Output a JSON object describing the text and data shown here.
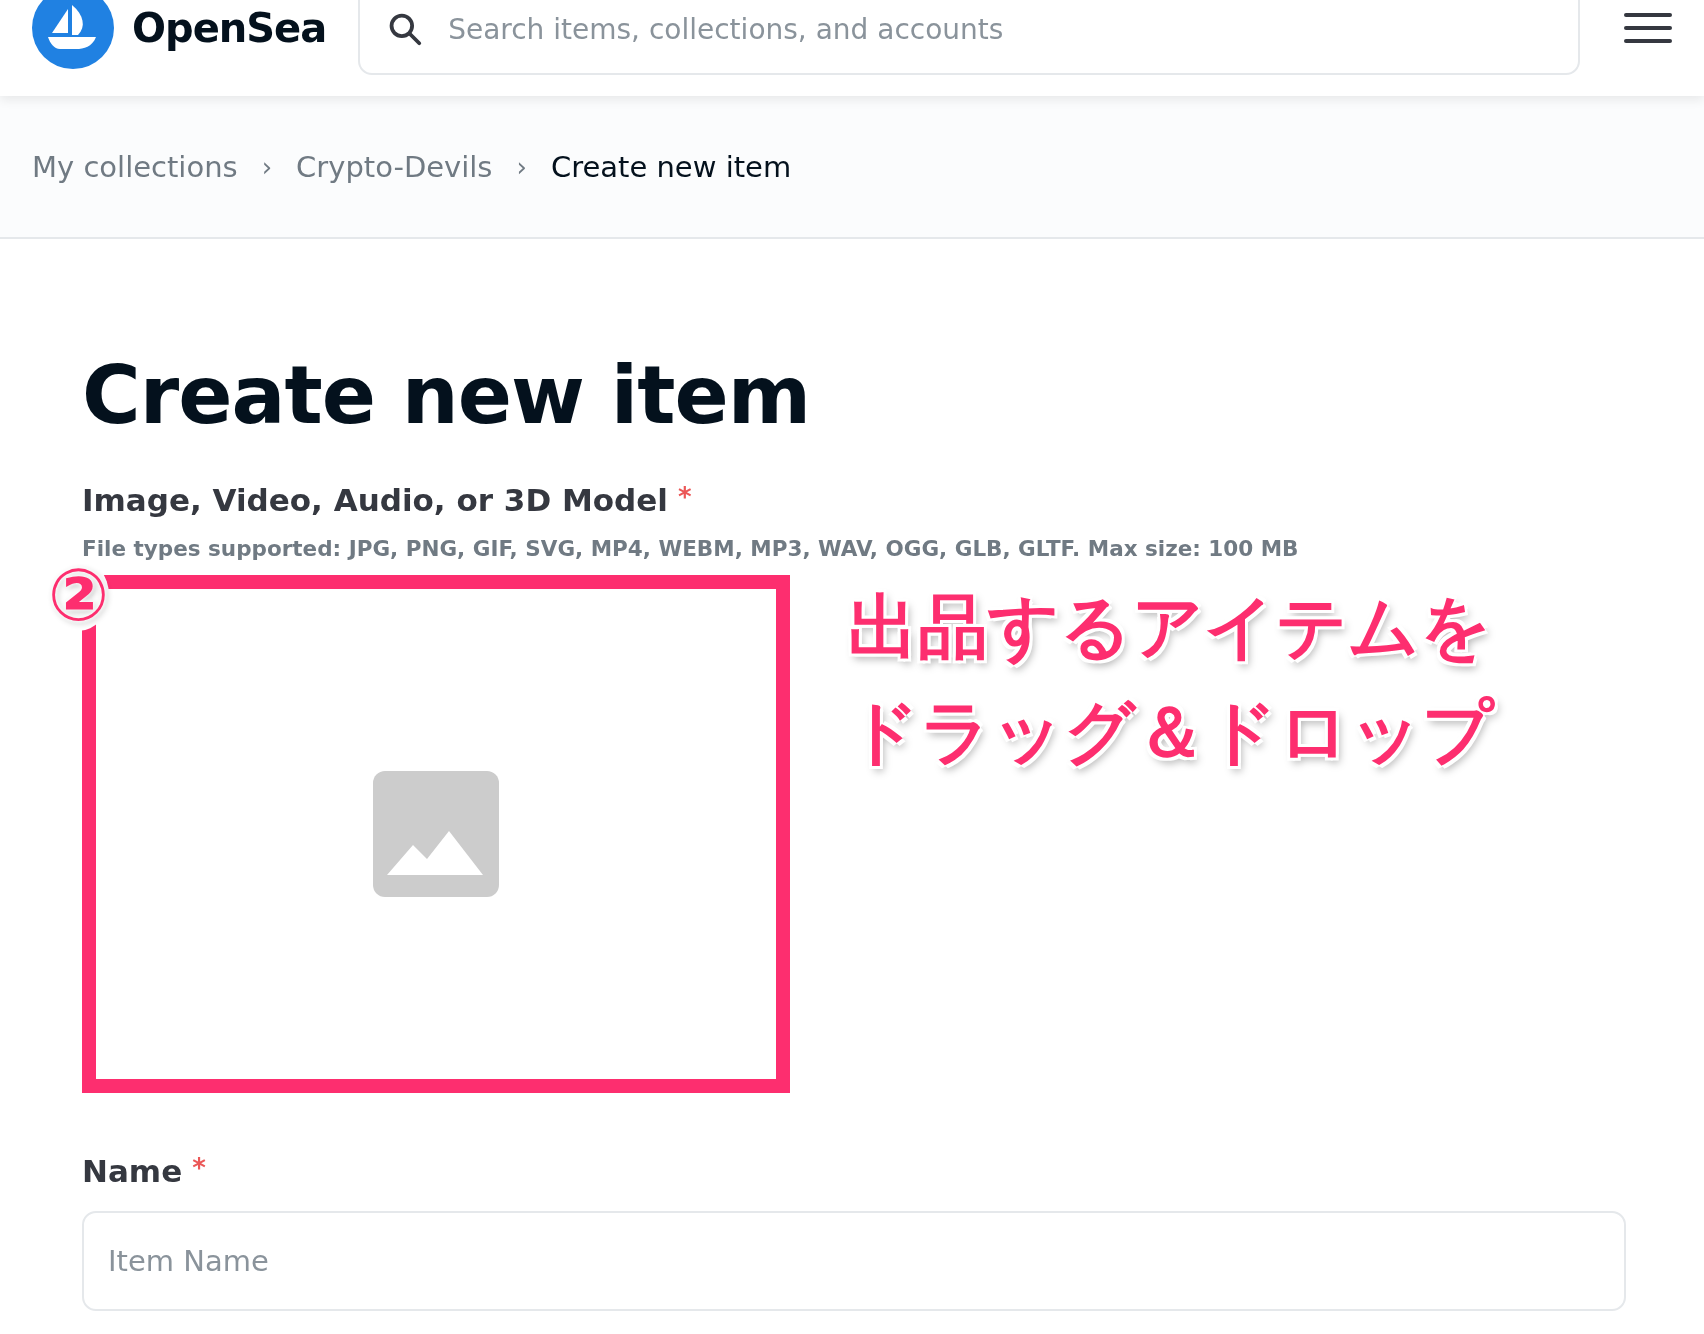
{
  "header": {
    "logo_text": "OpenSea",
    "search": {
      "placeholder": "Search items, collections, and accounts"
    }
  },
  "breadcrumbs": [
    {
      "label": "My collections",
      "current": false,
      "separator": "›"
    },
    {
      "label": "Crypto-Devils",
      "current": false,
      "separator": "›"
    },
    {
      "label": "Create new item",
      "current": true
    }
  ],
  "page": {
    "title": "Create new item",
    "media": {
      "label": "Image, Video, Audio, or 3D Model",
      "required_mark": "*",
      "hint": "File types supported: JPG, PNG, GIF, SVG, MP4, WEBM, MP3, WAV, OGG, GLB, GLTF. Max size: 100 MB"
    },
    "name_field": {
      "label": "Name",
      "required_mark": "*",
      "placeholder": "Item Name"
    }
  },
  "annotation": {
    "step": "②",
    "caption_lines": [
      "出品するアイテムを",
      "ドラッグ＆ドロップ"
    ]
  }
}
